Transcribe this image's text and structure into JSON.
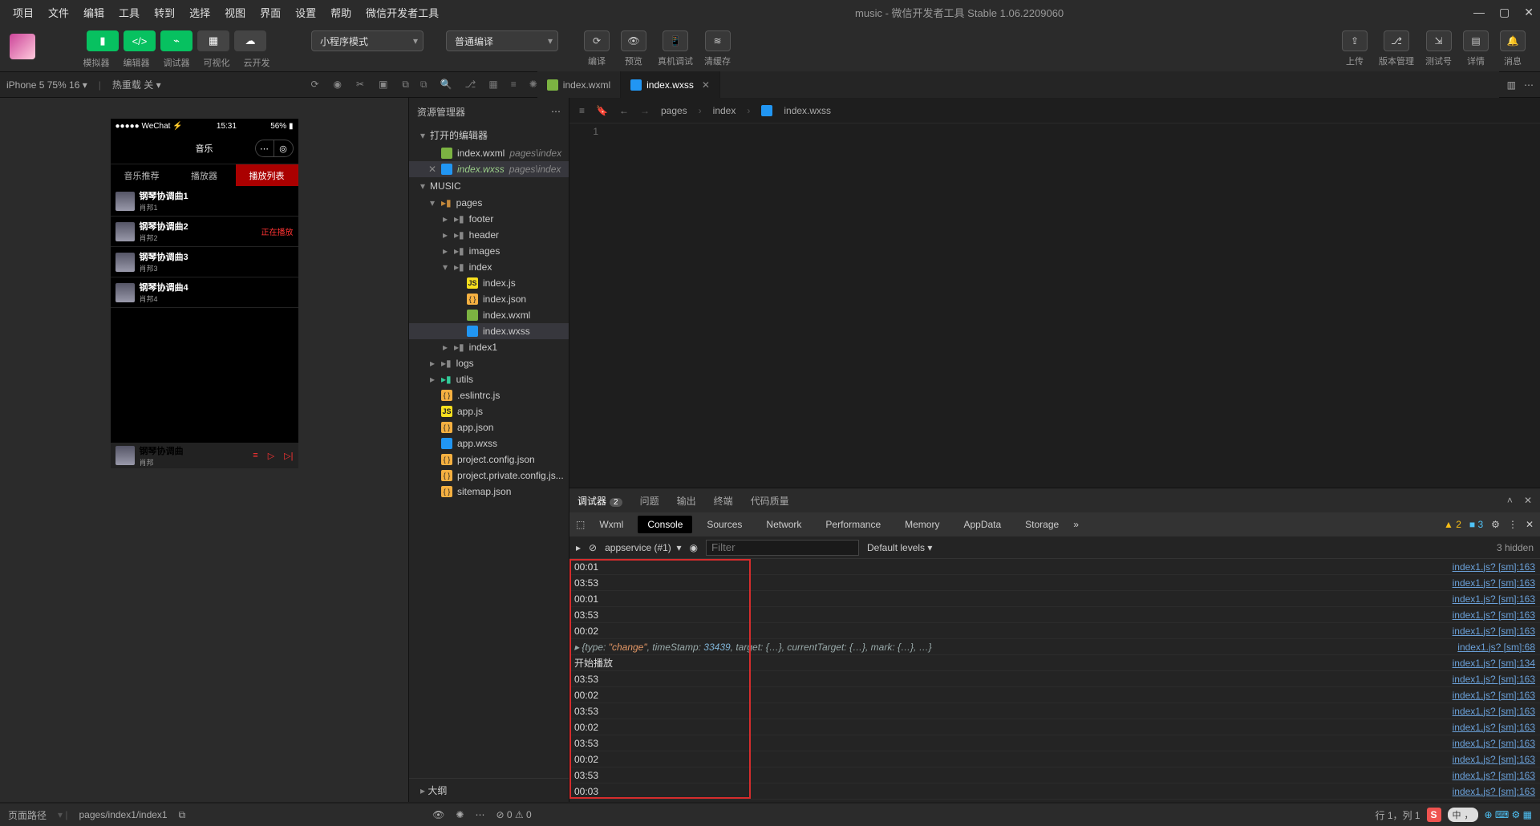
{
  "window": {
    "title_left": "music",
    "title_sep": " - ",
    "title_right": "微信开发者工具 Stable 1.06.2209060"
  },
  "menu": [
    "项目",
    "文件",
    "编辑",
    "工具",
    "转到",
    "选择",
    "视图",
    "界面",
    "设置",
    "帮助",
    "微信开发者工具"
  ],
  "toolbar": {
    "groupA_labels": [
      "模拟器",
      "编辑器",
      "调试器",
      "可视化",
      "云开发"
    ],
    "mode_dropdown": "小程序模式",
    "compile_dropdown": "普通编译",
    "right_labels": [
      "编译",
      "预览",
      "真机调试",
      "清缓存"
    ],
    "far_labels": [
      "上传",
      "版本管理",
      "测试号",
      "详情",
      "消息"
    ]
  },
  "secbar": {
    "device": "iPhone 5 75% 16",
    "hot_reload": "热重载 关"
  },
  "explorer": {
    "title": "资源管理器",
    "open_editors": "打开的编辑器",
    "open_files": [
      {
        "name": "index.wxml",
        "path": "pages\\index",
        "kind": "wxml"
      },
      {
        "name": "index.wxss",
        "path": "pages\\index",
        "kind": "wxss",
        "dirty": true
      }
    ],
    "project": "MUSIC",
    "tree": [
      {
        "d": 1,
        "chev": "▾",
        "kind": "folder",
        "name": "pages"
      },
      {
        "d": 2,
        "chev": "▸",
        "kind": "folder-d",
        "name": "footer"
      },
      {
        "d": 2,
        "chev": "▸",
        "kind": "folder-d",
        "name": "header"
      },
      {
        "d": 2,
        "chev": "▸",
        "kind": "folder-d",
        "name": "images"
      },
      {
        "d": 2,
        "chev": "▾",
        "kind": "folder-d",
        "name": "index"
      },
      {
        "d": 3,
        "kind": "js",
        "name": "index.js"
      },
      {
        "d": 3,
        "kind": "json",
        "name": "index.json"
      },
      {
        "d": 3,
        "kind": "wxml",
        "name": "index.wxml"
      },
      {
        "d": 3,
        "kind": "wxss",
        "name": "index.wxss",
        "sel": true
      },
      {
        "d": 2,
        "chev": "▸",
        "kind": "folder-d",
        "name": "index1"
      },
      {
        "d": 1,
        "chev": "▸",
        "kind": "folder-d",
        "name": "logs"
      },
      {
        "d": 1,
        "chev": "▸",
        "kind": "folder-g",
        "name": "utils"
      },
      {
        "d": 1,
        "kind": "json",
        "name": ".eslintrc.js",
        "js_circle": true
      },
      {
        "d": 1,
        "kind": "js",
        "name": "app.js"
      },
      {
        "d": 1,
        "kind": "json",
        "name": "app.json"
      },
      {
        "d": 1,
        "kind": "wxss",
        "name": "app.wxss"
      },
      {
        "d": 1,
        "kind": "json",
        "name": "project.config.json"
      },
      {
        "d": 1,
        "kind": "json",
        "name": "project.private.config.js..."
      },
      {
        "d": 1,
        "kind": "json",
        "name": "sitemap.json"
      }
    ],
    "outline": "大纲"
  },
  "editor": {
    "tabs": [
      {
        "name": "index.wxml",
        "kind": "wxml"
      },
      {
        "name": "index.wxss",
        "kind": "wxss",
        "active": true,
        "close": true
      }
    ],
    "breadcrumb": [
      "pages",
      "index",
      "index.wxss"
    ],
    "line_number": "1"
  },
  "debugger": {
    "primary_tabs": [
      {
        "name": "调试器",
        "badge": "2",
        "active": true
      },
      {
        "name": "问题"
      },
      {
        "name": "输出"
      },
      {
        "name": "终端"
      },
      {
        "name": "代码质量"
      }
    ],
    "devtools_tabs": [
      "Wxml",
      "Console",
      "Sources",
      "Network",
      "Performance",
      "Memory",
      "AppData",
      "Storage"
    ],
    "devtools_active": "Console",
    "warn_count": "▲ 2",
    "info_count": "■ 3",
    "context": "appservice (#1)",
    "filter_placeholder": "Filter",
    "level_label": "Default levels ▾",
    "hidden_label": "3 hidden",
    "logs": [
      {
        "msg": "00:01",
        "src": "index1.js? [sm]:163"
      },
      {
        "msg": "03:53",
        "src": "index1.js? [sm]:163"
      },
      {
        "msg": "00:01",
        "src": "index1.js? [sm]:163"
      },
      {
        "msg": "03:53",
        "src": "index1.js? [sm]:163"
      },
      {
        "msg": "00:02",
        "src": "index1.js? [sm]:163"
      },
      {
        "obj": true,
        "src": "index1.js? [sm]:68"
      },
      {
        "msg": "开始播放",
        "src": "index1.js? [sm]:134"
      },
      {
        "msg": "03:53",
        "src": "index1.js? [sm]:163"
      },
      {
        "msg": "00:02",
        "src": "index1.js? [sm]:163"
      },
      {
        "msg": "03:53",
        "src": "index1.js? [sm]:163"
      },
      {
        "msg": "00:02",
        "src": "index1.js? [sm]:163"
      },
      {
        "msg": "03:53",
        "src": "index1.js? [sm]:163"
      },
      {
        "msg": "00:02",
        "src": "index1.js? [sm]:163"
      },
      {
        "msg": "03:53",
        "src": "index1.js? [sm]:163"
      },
      {
        "msg": "00:03",
        "src": "index1.js? [sm]:163"
      }
    ],
    "obj_render": {
      "prefix": "▸ {type: ",
      "type": "\"change\"",
      "mid1": ", timeStamp: ",
      "ts": "33439",
      "rest": ", target: {…}, currentTarget: {…}, mark: {…}, …}"
    }
  },
  "simulator": {
    "status_left": "●●●●● WeChat ⚡",
    "status_time": "15:31",
    "status_right": "56% ▮",
    "nav_title": "音乐",
    "tabs": [
      "音乐推荐",
      "播放器",
      "播放列表"
    ],
    "active_tab": 2,
    "songs": [
      {
        "t": "钢琴协调曲1",
        "a": "肖邦1"
      },
      {
        "t": "钢琴协调曲2",
        "a": "肖邦2",
        "playing": "正在播放"
      },
      {
        "t": "钢琴协调曲3",
        "a": "肖邦3"
      },
      {
        "t": "钢琴协调曲4",
        "a": "肖邦4"
      }
    ],
    "player_title": "钢琴协调曲",
    "player_artist": "肖邦"
  },
  "statusbar": {
    "path_label": "页面路径",
    "path": "pages/index1/index1",
    "problems": "⊘ 0 ⚠ 0",
    "cursor": "行 1，列 1",
    "ime": "S",
    "ime_text": "中"
  }
}
